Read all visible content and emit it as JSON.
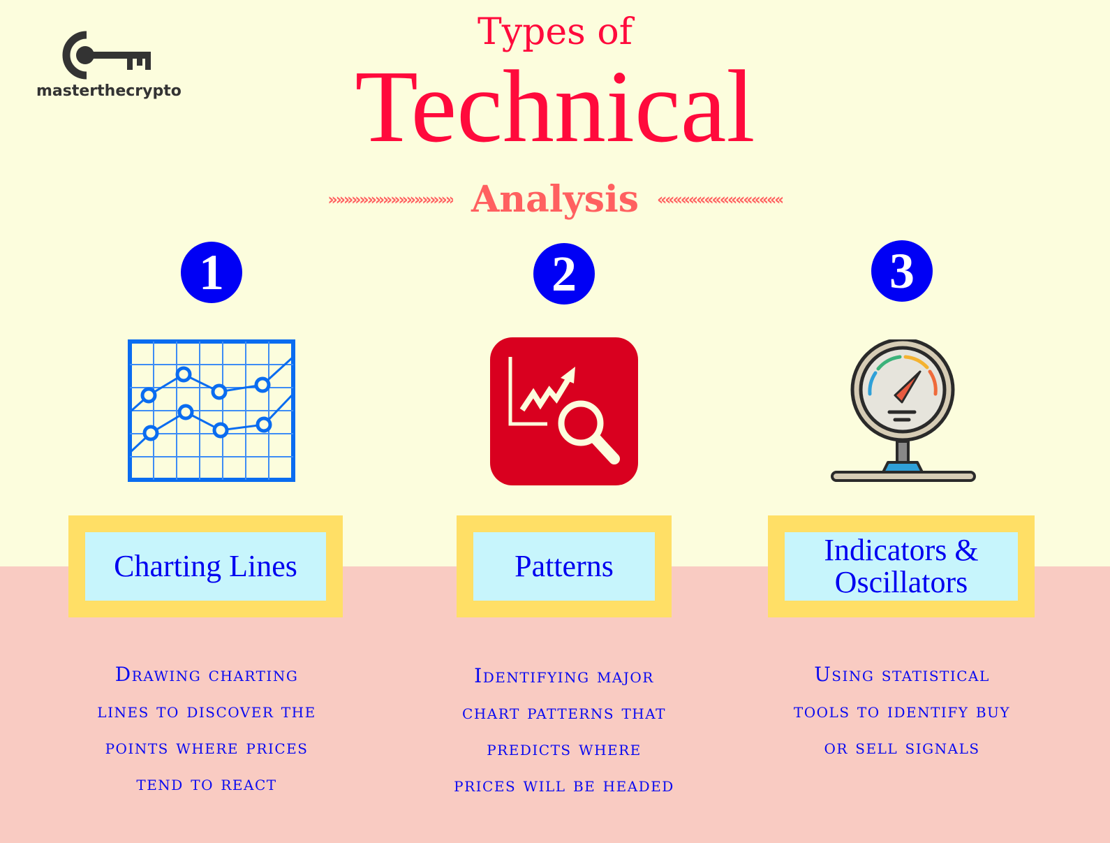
{
  "brand": {
    "name": "masterthecrypto",
    "logo_icon": "key-icon"
  },
  "title": {
    "line1": "Types of",
    "line2": "Technical",
    "line3": "Analysis",
    "left_ornament": "»»»»»»»»»»»»»»»»",
    "right_ornament": "««««««««««««««««"
  },
  "colors": {
    "background_top": "#fcfddd",
    "background_bottom": "#f9cbc2",
    "title": "#ff0a3c",
    "subtitle": "#ff6060",
    "badge": "#0000f5",
    "label_border": "#ffdf66",
    "label_fill": "#c7f5fc",
    "text_blue": "#0a0af0",
    "patterns_icon_bg": "#d9001f"
  },
  "columns": [
    {
      "number": "1",
      "icon": "line-chart-grid-icon",
      "label": "Charting Lines",
      "description": [
        "Drawing charting",
        "lines to discover the",
        "points where prices",
        "tend to react"
      ]
    },
    {
      "number": "2",
      "icon": "chart-magnifier-icon",
      "label": "Patterns",
      "description": [
        "Identifying major",
        "chart patterns that",
        "predicts where",
        "prices will be headed"
      ]
    },
    {
      "number": "3",
      "icon": "gauge-meter-icon",
      "label_line1": "Indicators &",
      "label_line2": "Oscillators",
      "description": [
        "Using statistical",
        "tools to identify buy",
        "or sell signals"
      ]
    }
  ]
}
